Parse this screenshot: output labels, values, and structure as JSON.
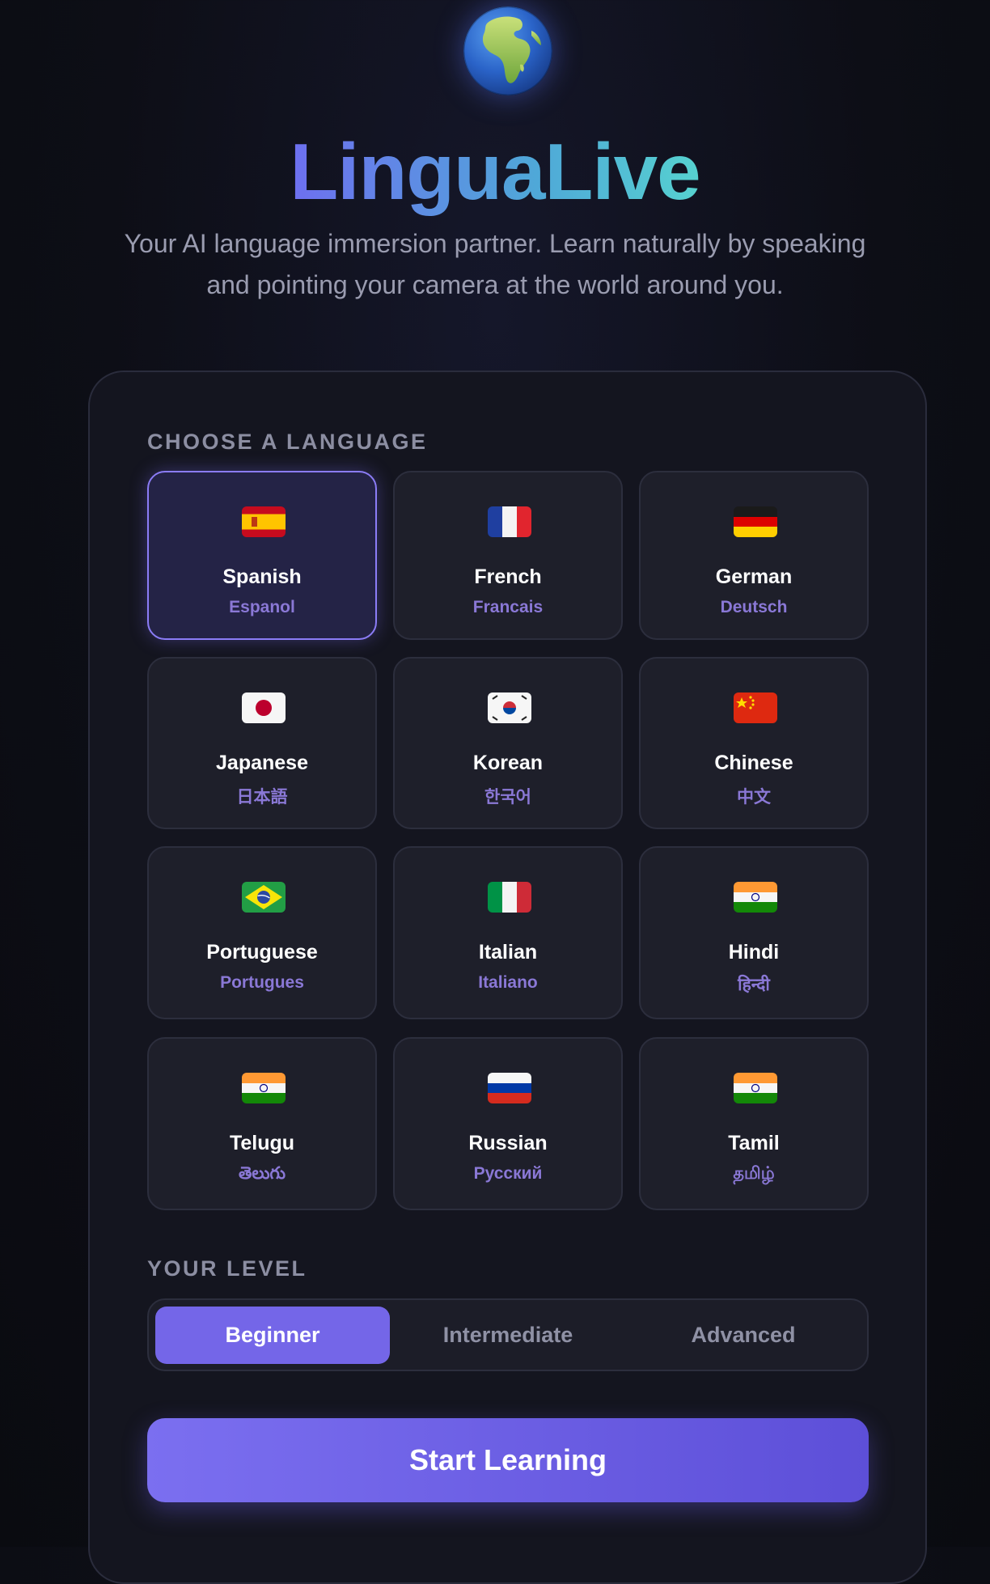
{
  "hero": {
    "icon": "globe-africa-icon",
    "title": "LinguaLive",
    "subtitle": "Your AI language immersion partner. Learn naturally by speaking and pointing your camera at the world around you."
  },
  "language_section": {
    "label": "CHOOSE A LANGUAGE",
    "languages": [
      {
        "name": "Spanish",
        "native": "Espanol",
        "flag": "spain-flag-icon",
        "selected": true
      },
      {
        "name": "French",
        "native": "Francais",
        "flag": "france-flag-icon",
        "selected": false
      },
      {
        "name": "German",
        "native": "Deutsch",
        "flag": "germany-flag-icon",
        "selected": false
      },
      {
        "name": "Japanese",
        "native": "日本語",
        "flag": "japan-flag-icon",
        "selected": false
      },
      {
        "name": "Korean",
        "native": "한국어",
        "flag": "south-korea-flag-icon",
        "selected": false
      },
      {
        "name": "Chinese",
        "native": "中文",
        "flag": "china-flag-icon",
        "selected": false
      },
      {
        "name": "Portuguese",
        "native": "Portugues",
        "flag": "brazil-flag-icon",
        "selected": false
      },
      {
        "name": "Italian",
        "native": "Italiano",
        "flag": "italy-flag-icon",
        "selected": false
      },
      {
        "name": "Hindi",
        "native": "हिन्दी",
        "flag": "india-flag-icon",
        "selected": false
      },
      {
        "name": "Telugu",
        "native": "తెలుగు",
        "flag": "india-flag-icon",
        "selected": false
      },
      {
        "name": "Russian",
        "native": "Русский",
        "flag": "russia-flag-icon",
        "selected": false
      },
      {
        "name": "Tamil",
        "native": "தமிழ்",
        "flag": "india-flag-icon",
        "selected": false
      }
    ]
  },
  "level_section": {
    "label": "YOUR LEVEL",
    "options": [
      "Beginner",
      "Intermediate",
      "Advanced"
    ],
    "selected": "Beginner"
  },
  "start_button": {
    "label": "Start Learning"
  },
  "colors": {
    "accent": "#7466e8",
    "title_gradient_start": "#6e6ff0",
    "title_gradient_end": "#56d2d0",
    "native_text": "#8a78d6",
    "background": "#0d0e16"
  }
}
